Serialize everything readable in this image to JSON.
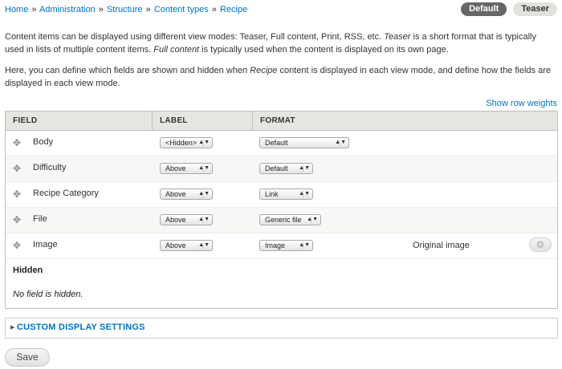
{
  "breadcrumb": {
    "items": [
      "Home",
      "Administration",
      "Structure",
      "Content types",
      "Recipe"
    ],
    "separator": "»"
  },
  "tabs": [
    {
      "label": "Default",
      "active": true
    },
    {
      "label": "Teaser",
      "active": false
    }
  ],
  "intro": {
    "p1_a": "Content items can be displayed using different view modes: Teaser, Full content, Print, RSS, etc. ",
    "p1_em1": "Teaser",
    "p1_b": " is a short format that is typically used in lists of multiple content items. ",
    "p1_em2": "Full content",
    "p1_c": " is typically used when the content is displayed on its own page.",
    "p2_a": "Here, you can define which fields are shown and hidden when ",
    "p2_em": "Recipe",
    "p2_b": " content is displayed in each view mode, and define how the fields are displayed in each view mode."
  },
  "show_row_weights": "Show row weights",
  "table": {
    "headers": {
      "field": "FIELD",
      "label": "LABEL",
      "format": "FORMAT"
    },
    "rows": [
      {
        "field": "Body",
        "label": "<Hidden>",
        "format": "Default",
        "summary": "",
        "gear": false
      },
      {
        "field": "Difficulty",
        "label": "Above",
        "format": "Default",
        "summary": "",
        "gear": false
      },
      {
        "field": "Recipe Category",
        "label": "Above",
        "format": "Link",
        "summary": "",
        "gear": false
      },
      {
        "field": "File",
        "label": "Above",
        "format": "Generic file",
        "summary": "",
        "gear": false
      },
      {
        "field": "Image",
        "label": "Above",
        "format": "Image",
        "summary": "Original image",
        "gear": true
      }
    ],
    "hidden_title": "Hidden",
    "hidden_message": "No field is hidden."
  },
  "custom_display": {
    "legend": "CUSTOM DISPLAY SETTINGS"
  },
  "actions": {
    "save": "Save"
  },
  "colors": {
    "link": "#0074bd",
    "active_tab": "#666666",
    "header_bg": "#e6e6e1"
  },
  "icons": {
    "drag": "drag-handle-icon",
    "gear": "gear-icon",
    "collapse": "triangle-right-icon"
  }
}
